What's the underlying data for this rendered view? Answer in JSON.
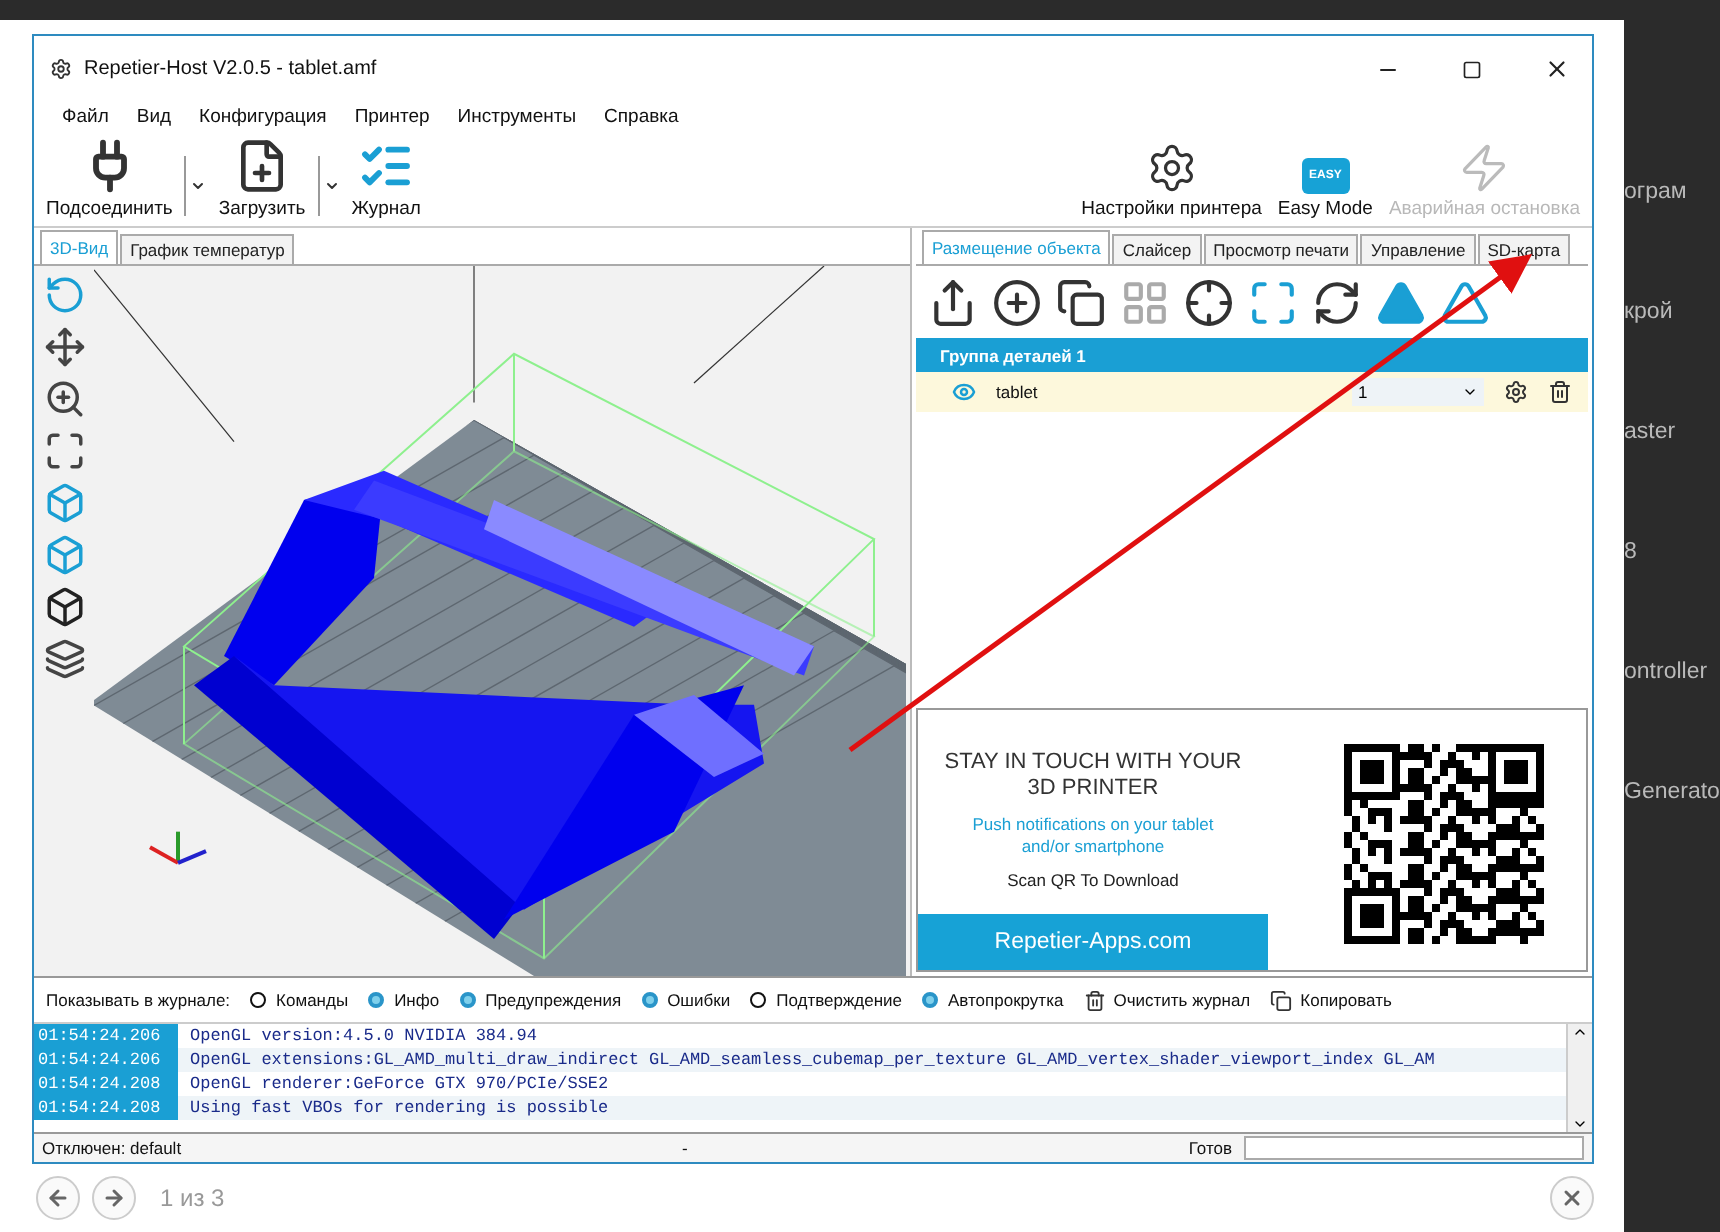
{
  "window": {
    "title": "Repetier-Host V2.0.5 - tablet.amf"
  },
  "menu": [
    "Файл",
    "Вид",
    "Конфигурация",
    "Принтер",
    "Инструменты",
    "Справка"
  ],
  "toolbar_left": [
    {
      "kind": "plug",
      "label": "Подсоединить",
      "dropdown": true
    },
    {
      "kind": "load",
      "label": "Загрузить",
      "dropdown": true
    },
    {
      "kind": "log",
      "label": "Журнал",
      "dropdown": false
    }
  ],
  "toolbar_right": [
    {
      "kind": "settings",
      "label": "Настройки принтера",
      "disabled": false
    },
    {
      "kind": "easy",
      "label": "Easy Mode",
      "badge": "EASY",
      "disabled": false
    },
    {
      "kind": "stop",
      "label": "Аварийная остановка",
      "disabled": true
    }
  ],
  "view_tabs": [
    {
      "label": "3D-Вид",
      "selected": true
    },
    {
      "label": "График температур",
      "selected": false
    }
  ],
  "panel_tabs": [
    {
      "label": "Размещение объекта",
      "selected": true
    },
    {
      "label": "Слайсер",
      "selected": false
    },
    {
      "label": "Просмотр печати",
      "selected": false
    },
    {
      "label": "Управление",
      "selected": false
    },
    {
      "label": "SD-карта",
      "selected": false
    }
  ],
  "object_group": {
    "title": "Группа деталей 1",
    "items": [
      {
        "name": "tablet",
        "visible": true,
        "extruder": "1"
      }
    ]
  },
  "promo": {
    "heading": "STAY IN TOUCH WITH YOUR 3D PRINTER",
    "subtext": "Push notifications on your tablet and/or smartphone",
    "scan": "Scan QR To Download",
    "button": "Repetier-Apps.com"
  },
  "log_filters": {
    "label": "Показывать в журнале:",
    "options": [
      {
        "label": "Команды",
        "checked": false
      },
      {
        "label": "Инфо",
        "checked": true
      },
      {
        "label": "Предупреждения",
        "checked": true
      },
      {
        "label": "Ошибки",
        "checked": true
      },
      {
        "label": "Подтверждение",
        "checked": false
      },
      {
        "label": "Автопрокрутка",
        "checked": true
      }
    ],
    "actions": [
      {
        "kind": "clear",
        "label": "Очистить журнал"
      },
      {
        "kind": "copy",
        "label": "Копировать"
      }
    ]
  },
  "log": [
    {
      "time": "01:54:24.206",
      "message": "OpenGL version:4.5.0 NVIDIA 384.94"
    },
    {
      "time": "01:54:24.206",
      "message": "OpenGL extensions:GL_AMD_multi_draw_indirect GL_AMD_seamless_cubemap_per_texture GL_AMD_vertex_shader_viewport_index GL_AM"
    },
    {
      "time": "01:54:24.208",
      "message": "OpenGL renderer:GeForce GTX 970/PCIe/SSE2"
    },
    {
      "time": "01:54:24.208",
      "message": "Using fast VBOs for rendering is possible"
    }
  ],
  "status_bar": {
    "connection": "Отключен: default",
    "middle": "-",
    "state": "Готов"
  },
  "lightbox": {
    "counter": "1 из 3"
  },
  "background_page": [
    "ограм",
    "крой",
    "aster",
    "8",
    "ontroller",
    "Generato"
  ]
}
